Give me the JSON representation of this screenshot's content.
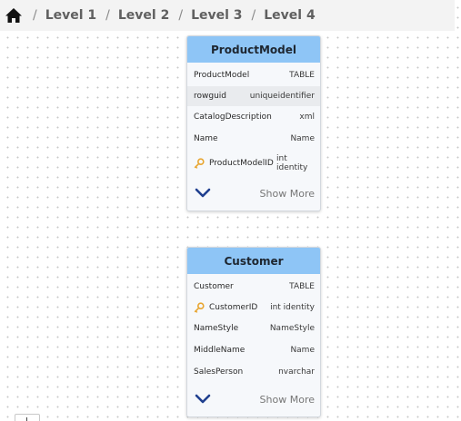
{
  "breadcrumb": {
    "home_icon": "home-icon",
    "separator": "/",
    "levels": [
      "Level 1",
      "Level 2",
      "Level 3",
      "Level 4"
    ]
  },
  "cards": [
    {
      "title": "ProductModel",
      "rows": [
        {
          "name": "ProductModel",
          "type": "TABLE"
        },
        {
          "name": "rowguid",
          "type": "uniqueidentifier"
        },
        {
          "name": "CatalogDescription",
          "type": "xml"
        },
        {
          "name": "Name",
          "type": "Name"
        },
        {
          "name": "ProductModelID",
          "type_line1": "int",
          "type_line2": "identity",
          "icon": "key-icon"
        }
      ],
      "show_more": "Show More"
    },
    {
      "title": "Customer",
      "rows": [
        {
          "name": "Customer",
          "type": "TABLE"
        },
        {
          "name": "CustomerID",
          "type": "int identity",
          "icon": "key-icon"
        },
        {
          "name": "NameStyle",
          "type": "NameStyle"
        },
        {
          "name": "MiddleName",
          "type": "Name"
        },
        {
          "name": "SalesPerson",
          "type": "nvarchar"
        }
      ],
      "show_more": "Show More"
    }
  ],
  "colors": {
    "header": "#8ec5f6",
    "chevron": "#1f3f8f",
    "key": "#e8a530"
  }
}
